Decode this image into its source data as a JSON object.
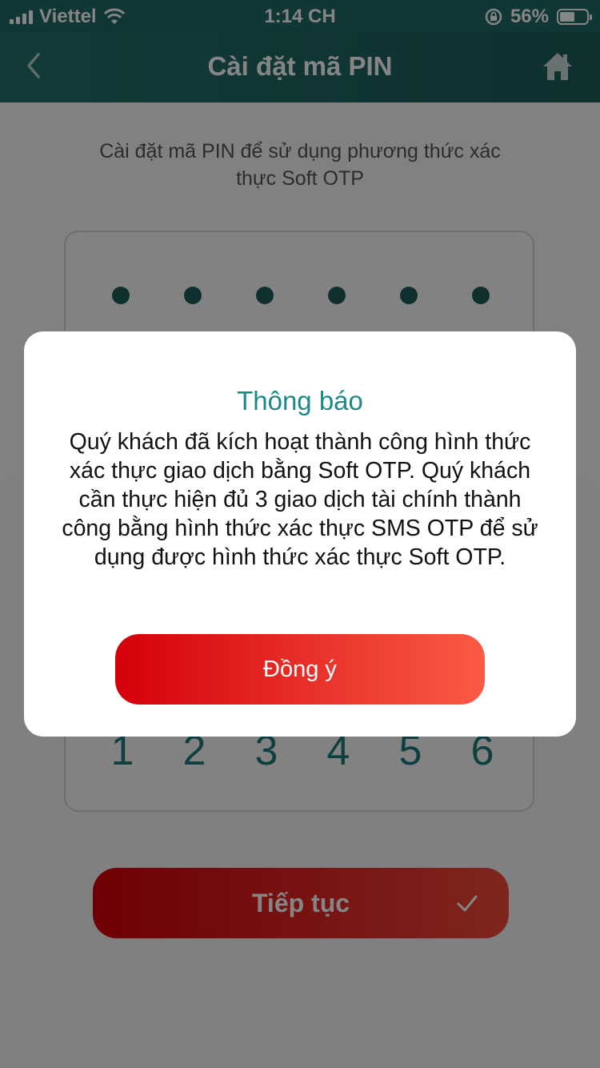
{
  "status_bar": {
    "carrier": "Viettel",
    "time": "1:14 CH",
    "battery_percent": "56%",
    "battery_level": 0.56
  },
  "nav": {
    "title": "Cài đặt mã PIN"
  },
  "page": {
    "subtitle": "Cài đặt mã PIN để sử dụng phương thức xác thực Soft OTP",
    "pin_digits": [
      "1",
      "2",
      "3",
      "4",
      "5",
      "6"
    ],
    "continue_label": "Tiếp tục"
  },
  "dialog": {
    "title": "Thông báo",
    "message": "Quý khách đã kích hoạt thành công hình thức xác thực giao dịch bằng Soft OTP. Quý khách cần thực hiện đủ 3 giao dịch tài chính thành công bằng hình thức xác thực SMS OTP để sử dụng được hình thức xác thực Soft OTP.",
    "confirm_label": "Đồng ý"
  },
  "colors": {
    "header": "#1f6a68",
    "accent_teal": "#1b8a86",
    "button_red": "#d4000a"
  },
  "icons": {
    "back": "chevron-left-icon",
    "home": "home-icon",
    "wifi": "wifi-icon",
    "rotation_lock": "rotation-lock-icon",
    "check": "check-icon"
  }
}
